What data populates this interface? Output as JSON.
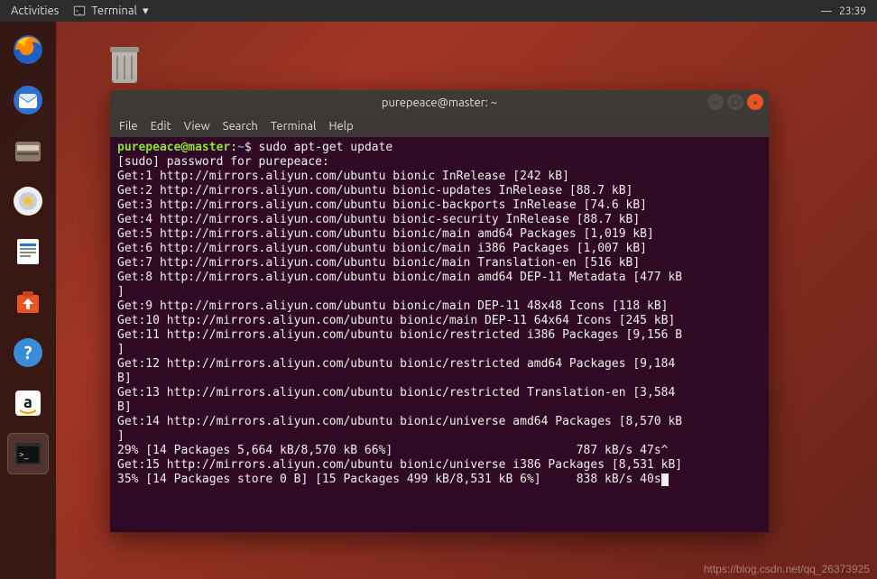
{
  "topbar": {
    "activities": "Activities",
    "app_label": "Terminal",
    "time": "23:39"
  },
  "desktop": {
    "trash_label": "Trash"
  },
  "terminal": {
    "title": "purepeace@master: ~",
    "menu": {
      "file": "File",
      "edit": "Edit",
      "view": "View",
      "search": "Search",
      "terminal": "Terminal",
      "help": "Help"
    },
    "prompt": {
      "user": "purepeace@master",
      "path": "~",
      "sep": ":",
      "end": "$"
    },
    "command": "sudo apt-get update",
    "lines": [
      "[sudo] password for purepeace:",
      "Get:1 http://mirrors.aliyun.com/ubuntu bionic InRelease [242 kB]",
      "Get:2 http://mirrors.aliyun.com/ubuntu bionic-updates InRelease [88.7 kB]",
      "Get:3 http://mirrors.aliyun.com/ubuntu bionic-backports InRelease [74.6 kB]",
      "Get:4 http://mirrors.aliyun.com/ubuntu bionic-security InRelease [88.7 kB]",
      "Get:5 http://mirrors.aliyun.com/ubuntu bionic/main amd64 Packages [1,019 kB]",
      "Get:6 http://mirrors.aliyun.com/ubuntu bionic/main i386 Packages [1,007 kB]",
      "Get:7 http://mirrors.aliyun.com/ubuntu bionic/main Translation-en [516 kB]",
      "Get:8 http://mirrors.aliyun.com/ubuntu bionic/main amd64 DEP-11 Metadata [477 kB",
      "]",
      "Get:9 http://mirrors.aliyun.com/ubuntu bionic/main DEP-11 48x48 Icons [118 kB]",
      "Get:10 http://mirrors.aliyun.com/ubuntu bionic/main DEP-11 64x64 Icons [245 kB]",
      "Get:11 http://mirrors.aliyun.com/ubuntu bionic/restricted i386 Packages [9,156 B",
      "]",
      "Get:12 http://mirrors.aliyun.com/ubuntu bionic/restricted amd64 Packages [9,184 ",
      "B]",
      "Get:13 http://mirrors.aliyun.com/ubuntu bionic/restricted Translation-en [3,584 ",
      "B]",
      "Get:14 http://mirrors.aliyun.com/ubuntu bionic/universe amd64 Packages [8,570 kB",
      "]",
      "29% [14 Packages 5,664 kB/8,570 kB 66%]                          787 kB/s 47s^",
      "Get:15 http://mirrors.aliyun.com/ubuntu bionic/universe i386 Packages [8,531 kB]",
      "35% [14 Packages store 0 B] [15 Packages 499 kB/8,531 kB 6%]     838 kB/s 40s"
    ]
  },
  "watermark": "https://blog.csdn.net/qq_26373925"
}
